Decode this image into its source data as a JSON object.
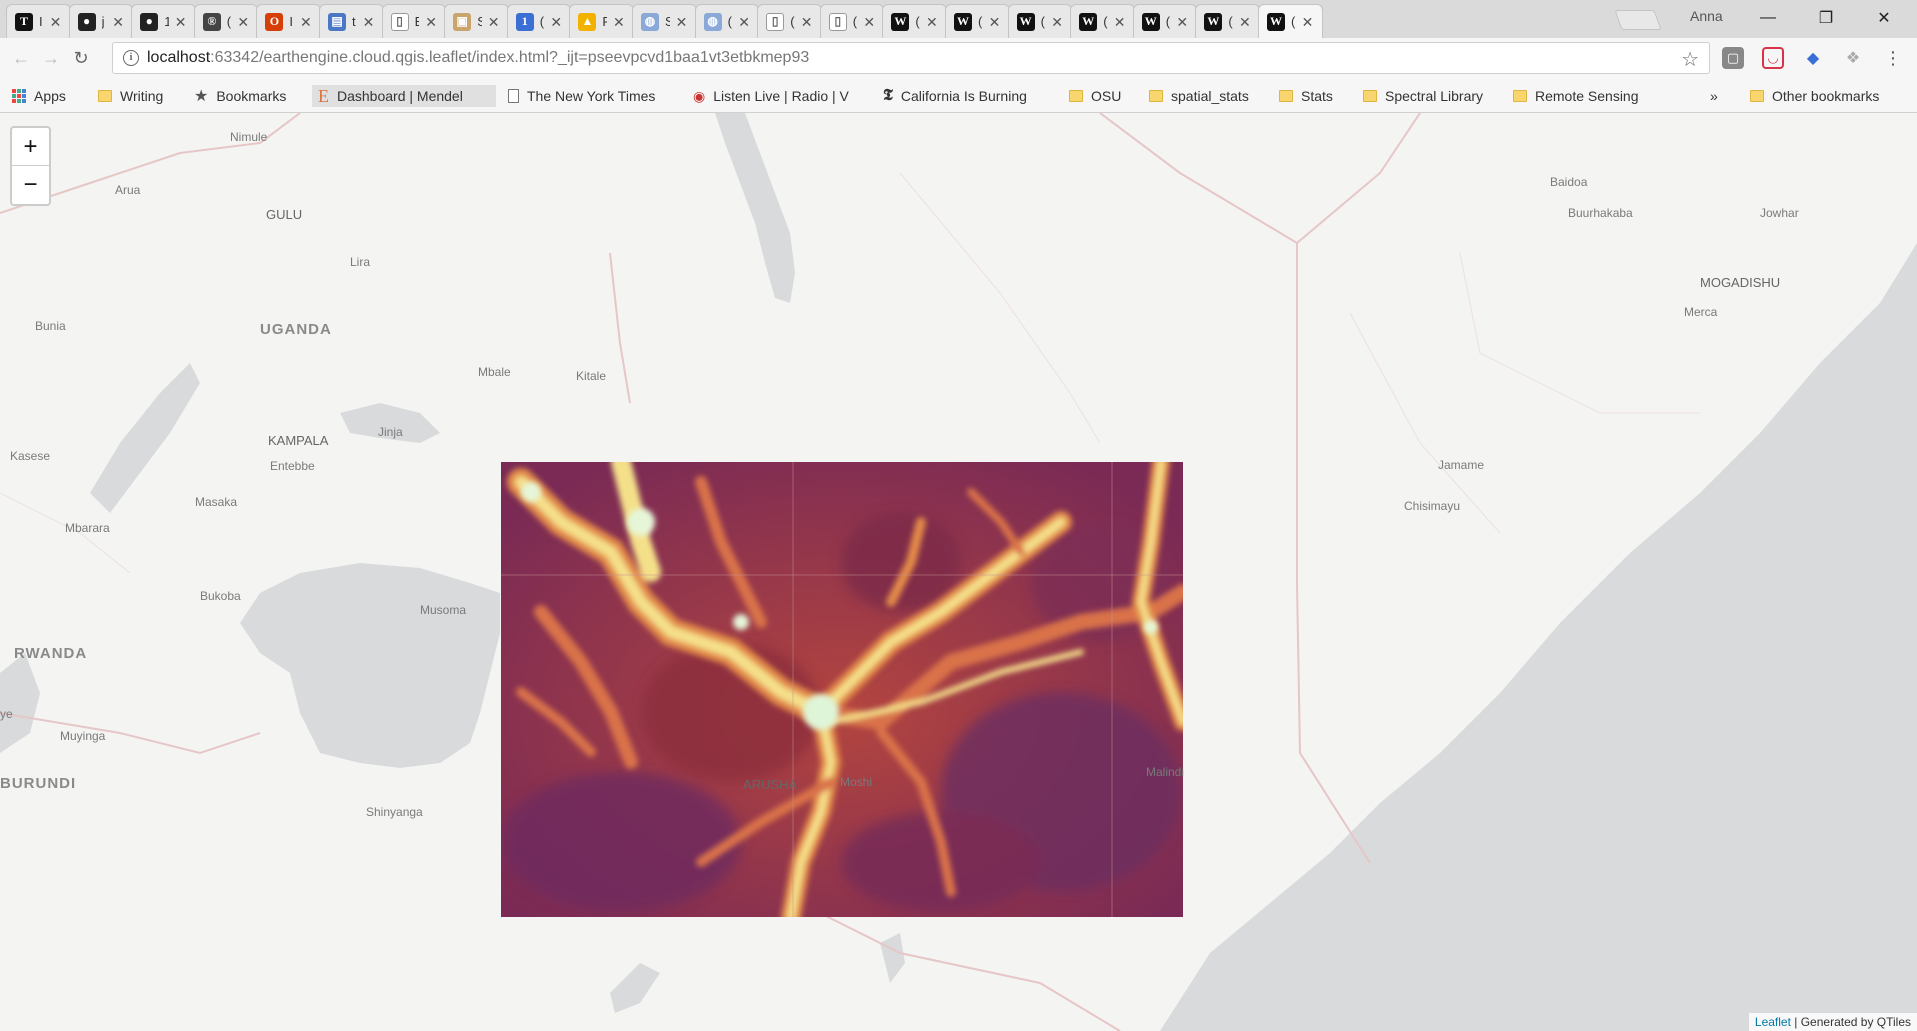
{
  "browser": {
    "tabs": [
      {
        "title": "I",
        "icon": "T"
      },
      {
        "title": "j",
        "icon": "github"
      },
      {
        "title": "1",
        "icon": "github"
      },
      {
        "title": "(",
        "icon": "R"
      },
      {
        "title": "I",
        "icon": "OSU"
      },
      {
        "title": "t",
        "icon": "calendar"
      },
      {
        "title": "E",
        "icon": "page"
      },
      {
        "title": "S",
        "icon": "image"
      },
      {
        "title": "(",
        "icon": "1"
      },
      {
        "title": "F",
        "icon": "drive"
      },
      {
        "title": "S",
        "icon": "globe"
      },
      {
        "title": "(",
        "icon": "globe"
      },
      {
        "title": "(",
        "icon": "page"
      },
      {
        "title": "(",
        "icon": "page"
      },
      {
        "title": "(",
        "icon": "WS"
      },
      {
        "title": "(",
        "icon": "WS"
      },
      {
        "title": "(",
        "icon": "WS"
      },
      {
        "title": "(",
        "icon": "WS"
      },
      {
        "title": "(",
        "icon": "WS"
      },
      {
        "title": "(",
        "icon": "WS"
      },
      {
        "title": "(",
        "icon": "WS"
      }
    ],
    "profile": "Anna",
    "url_host": "localhost",
    "url_rest": ":63342/earthengine.cloud.qgis.leaflet/index.html?_ijt=pseevpcvd1baa1vt3etbkmep93",
    "bookmarks": [
      {
        "label": "Apps",
        "icon": "apps-icon"
      },
      {
        "label": "Writing",
        "icon": "folder-icon"
      },
      {
        "label": "Bookmarks",
        "icon": "star-icon"
      },
      {
        "label": "Dashboard | Mendel",
        "icon": "mendeley-icon"
      },
      {
        "label": "The New York Times",
        "icon": "page-icon"
      },
      {
        "label": "Listen Live | Radio | V",
        "icon": "radio-icon"
      },
      {
        "label": "California Is Burning",
        "icon": "nyt-icon"
      },
      {
        "label": "OSU",
        "icon": "folder-icon"
      },
      {
        "label": "spatial_stats",
        "icon": "folder-icon"
      },
      {
        "label": "Stats",
        "icon": "folder-icon"
      },
      {
        "label": "Spectral Library",
        "icon": "folder-icon"
      },
      {
        "label": "Remote Sensing",
        "icon": "folder-icon"
      }
    ],
    "overflow": "»",
    "other_bookmarks": "Other bookmarks"
  },
  "map": {
    "zoom_in": "+",
    "zoom_out": "−",
    "attribution_link": "Leaflet",
    "attribution_text": " | Generated by QTiles",
    "places": {
      "nimule": "Nimule",
      "arua": "Arua",
      "gulu": "GULU",
      "lira": "Lira",
      "bunia": "Bunia",
      "uganda": "UGANDA",
      "mbale": "Mbale",
      "kitale": "Kitale",
      "kampala": "KAMPALA",
      "jinja": "Jinja",
      "entebbe": "Entebbe",
      "kasese": "Kasese",
      "masaka": "Masaka",
      "mbarara": "Mbarara",
      "bukoba": "Bukoba",
      "musoma": "Musoma",
      "rwanda": "RWANDA",
      "muyinga": "Muyinga",
      "burundi": "BURUNDI",
      "shinyanga": "Shinyanga",
      "arusha": "ARUSHA",
      "moshi": "Moshi",
      "malindi": "Malindi",
      "baidoa": "Baidoa",
      "buurhakaba": "Buurhakaba",
      "jowhar": "Jowhar",
      "mogadishu": "MOGADISHU",
      "merca": "Merca",
      "jamame": "Jamame",
      "chisimayu": "Chisimayu",
      "ye": "ye"
    }
  }
}
